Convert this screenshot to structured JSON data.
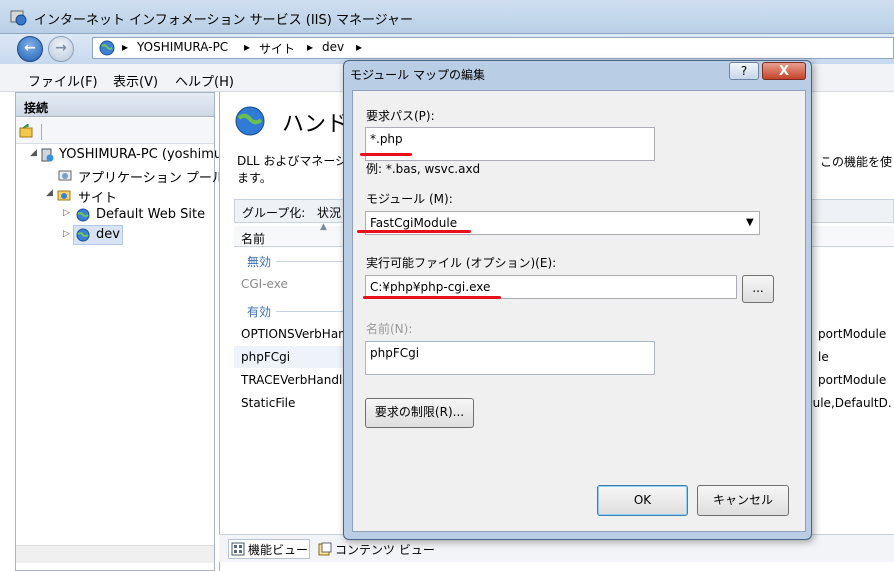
{
  "window": {
    "title": "インターネット インフォメーション サービス (IIS) マネージャー"
  },
  "address": {
    "crumbs": [
      "YOSHIMURA-PC",
      "サイト",
      "dev"
    ],
    "separator": "▸"
  },
  "menu": {
    "items": [
      "ファイル(F)",
      "表示(V)",
      "ヘルプ(H)"
    ]
  },
  "connections": {
    "title": "接続",
    "tree": [
      {
        "label": "YOSHIMURA-PC (yoshimur"
      },
      {
        "label": "アプリケーション プール"
      },
      {
        "label": "サイト"
      },
      {
        "label": "Default Web Site"
      },
      {
        "label": "dev"
      }
    ]
  },
  "main": {
    "title": "ハンド",
    "description_line1": "DLL およびマネージ",
    "description_line2": "ます。",
    "description_right": "この機能を使",
    "groupby_label": "グループ化:",
    "groupby_value": "状況",
    "column_name": "名前",
    "group_disabled": "無効",
    "group_enabled": "有効",
    "rows": [
      {
        "name": "CGI-exe",
        "right": ""
      },
      {
        "name": "OPTIONSVerbHand",
        "right": "portModule"
      },
      {
        "name": "phpFCgi",
        "right": "le"
      },
      {
        "name": "TRACEVerbHandle",
        "right": "portModule"
      },
      {
        "name": "StaticFile",
        "right": "dule,DefaultD."
      }
    ],
    "tabs": [
      "機能ビュー",
      "コンテンツ ビュー"
    ]
  },
  "dialog": {
    "title": "モジュール マップの編集",
    "help_label": "?",
    "close_label": "X",
    "request_path_label": "要求パス(P):",
    "request_path_value": "*.php",
    "request_path_example": "例: *.bas, wsvc.axd",
    "module_label": "モジュール (M):",
    "module_value": "FastCgiModule",
    "executable_label": "実行可能ファイル (オプション)(E):",
    "executable_value": "C:¥php¥php-cgi.exe",
    "browse_label": "...",
    "name_label": "名前(N):",
    "name_value": "phpFCgi",
    "restrictions_button": "要求の制限(R)...",
    "ok_button": "OK",
    "cancel_button": "キャンセル"
  },
  "colors": {
    "highlight_underline": "#e8101c",
    "dialog_frame": "#b9cde4"
  }
}
